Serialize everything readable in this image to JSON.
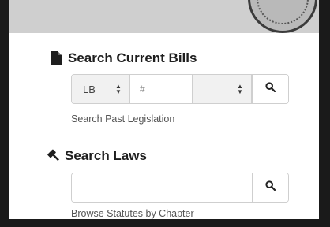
{
  "bills": {
    "title": "Search Current Bills",
    "prefix_value": "LB",
    "number_placeholder": "#",
    "type_value": "",
    "search_button_icon": "search-icon",
    "past_link": "Search Past Legislation"
  },
  "laws": {
    "title": "Search Laws",
    "input_value": "",
    "search_button_icon": "search-icon",
    "browse_link": "Browse Statutes by Chapter"
  },
  "icons": {
    "bills_title_icon": "file-icon",
    "laws_title_icon": "gavel-icon",
    "seal": "state-seal"
  },
  "colors": {
    "banner": "#cfcfcf",
    "text_dark": "#1e1e1e",
    "link": "#555555",
    "border": "#cfcfcf"
  }
}
